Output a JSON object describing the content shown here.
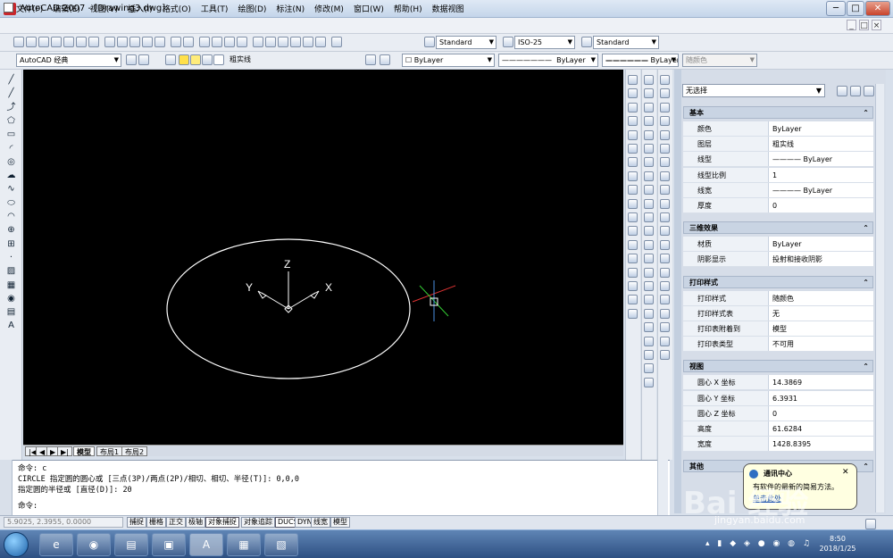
{
  "window": {
    "app_icon": "A",
    "title": "AutoCAD 2007 - [Drawing3.dwg]",
    "min": "─",
    "max": "□",
    "close": "✕",
    "doc_min": "_",
    "doc_max": "□",
    "doc_close": "×"
  },
  "menu": [
    "文件(F)",
    "编辑(E)",
    "视图(V)",
    "插入(I)",
    "格式(O)",
    "工具(T)",
    "绘图(D)",
    "标注(N)",
    "修改(M)",
    "窗口(W)",
    "帮助(H)",
    "数据视图"
  ],
  "toolbar": {
    "text_style": "Standard",
    "dim_style": "ISO-25",
    "table_style": "Standard",
    "workspace": "AutoCAD 经典",
    "layer": "粗实线",
    "color": "ByLayer",
    "linetype": "ByLayer",
    "lineweight": "ByLayer",
    "plotstyle": "随颜色"
  },
  "left_tools": [
    "line-icon",
    "construction-line-icon",
    "polyline-icon",
    "polygon-icon",
    "rectangle-icon",
    "arc-icon",
    "circle-icon",
    "revision-cloud-icon",
    "spline-icon",
    "ellipse-icon",
    "ellipse-arc-icon",
    "insert-block-icon",
    "make-block-icon",
    "point-icon",
    "hatch-icon",
    "gradient-icon",
    "region-icon",
    "table-icon",
    "mtext-icon"
  ],
  "left_glyphs": [
    "╱",
    "╱",
    "⤴",
    "⬠",
    "▭",
    "◜",
    "◎",
    "☁",
    "∿",
    "⬭",
    "◠",
    "⊕",
    "⊞",
    "·",
    "▨",
    "▦",
    "◉",
    "▤",
    "A"
  ],
  "canvas": {
    "axis_z": "Z",
    "axis_y": "Y",
    "axis_x": "X",
    "cursor_color": "#4a90e2",
    "circle_color": "#ffffff"
  },
  "layout_tabs": [
    "模型",
    "布局1",
    "布局2"
  ],
  "layout_nav": [
    "|◀",
    "◀",
    "▶",
    "▶|"
  ],
  "properties": {
    "selection": "无选择",
    "sections": [
      {
        "title": "基本",
        "rows": [
          [
            "颜色",
            "ByLayer"
          ],
          [
            "图层",
            "粗实线"
          ],
          [
            "线型",
            "———— ByLayer"
          ],
          [
            "线型比例",
            "1"
          ],
          [
            "线宽",
            "———— ByLayer"
          ],
          [
            "厚度",
            "0"
          ]
        ]
      },
      {
        "title": "三维效果",
        "rows": [
          [
            "材质",
            "ByLayer"
          ],
          [
            "阴影显示",
            "投射和接收阴影"
          ]
        ]
      },
      {
        "title": "打印样式",
        "rows": [
          [
            "打印样式",
            "随颜色"
          ],
          [
            "打印样式表",
            "无"
          ],
          [
            "打印表附着到",
            "模型"
          ],
          [
            "打印表类型",
            "不可用"
          ]
        ]
      },
      {
        "title": "视图",
        "rows": [
          [
            "圆心 X 坐标",
            "14.3869"
          ],
          [
            "圆心 Y 坐标",
            "6.3931"
          ],
          [
            "圆心 Z 坐标",
            "0"
          ],
          [
            "高度",
            "61.6284"
          ],
          [
            "宽度",
            "1428.8395"
          ]
        ]
      },
      {
        "title": "其他",
        "rows": []
      }
    ]
  },
  "command": {
    "lines": [
      "命令: c",
      "CIRCLE 指定圆的圆心或 [三点(3P)/两点(2P)/相切、相切、半径(T)]: 0,0,0",
      "指定圆的半径或 [直径(D)]: 20"
    ],
    "prompt": "命令:"
  },
  "status": {
    "coords": "5.9025, 2.3955, 0.0000",
    "buttons": [
      "捕捉",
      "栅格",
      "正交",
      "极轴",
      "对象捕捉",
      "对象追踪",
      "DUCS",
      "DYN",
      "线宽",
      "模型"
    ]
  },
  "balloon": {
    "title": "通讯中心",
    "text": "有软件的最新的简易方法。",
    "link": "单击此处"
  },
  "taskbar": {
    "clock_time": "8:50",
    "clock_date": "2018/1/25"
  },
  "watermark": {
    "main": "Bai 经验",
    "sub": "jingyan.baidu.com"
  }
}
